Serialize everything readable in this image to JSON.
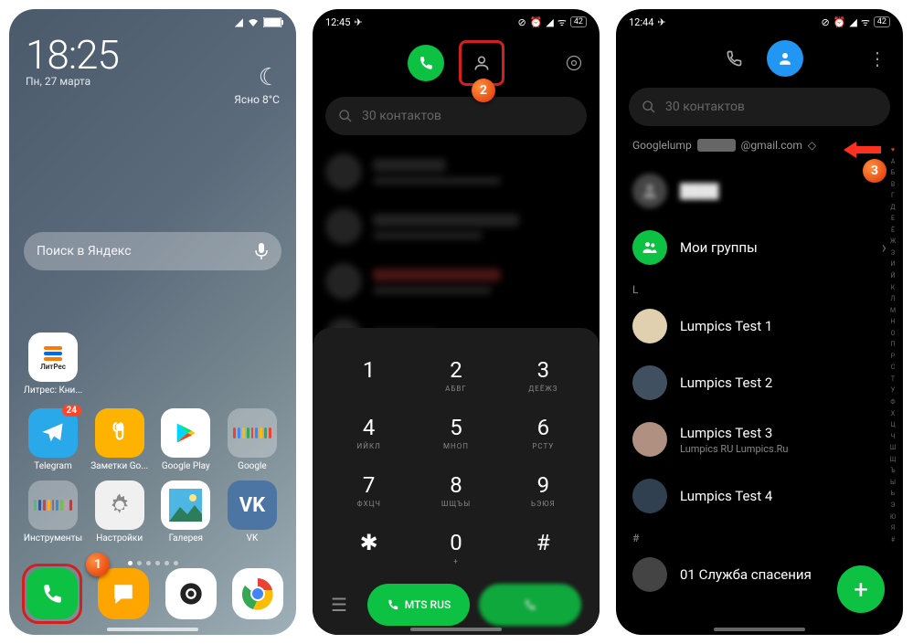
{
  "home": {
    "time": "18:25",
    "date": "Пн, 27 марта",
    "weather_label": "Ясно",
    "weather_temp": "8°C",
    "search_placeholder": "Поиск в Яндекс",
    "apps": {
      "litres": "Литрес: Кни...",
      "telegram": "Telegram",
      "telegram_badge": "24",
      "notes": "Заметки Go...",
      "playstore": "Google Play",
      "google": "Google",
      "tools": "Инструменты",
      "settings": "Настройки",
      "gallery": "Галерея",
      "vk": "VK"
    }
  },
  "s2": {
    "time": "12:45",
    "battery": "42",
    "search_placeholder": "30 контактов",
    "keypad": [
      {
        "n": "1",
        "s": ""
      },
      {
        "n": "2",
        "s": "АБВГ"
      },
      {
        "n": "3",
        "s": "ДЕЁЖЗ"
      },
      {
        "n": "4",
        "s": "ИЙКЛ"
      },
      {
        "n": "5",
        "s": "МНОП"
      },
      {
        "n": "6",
        "s": "РСТУ"
      },
      {
        "n": "7",
        "s": "ФХЦЧ"
      },
      {
        "n": "8",
        "s": "ШЩЪЫ"
      },
      {
        "n": "9",
        "s": "ЬЭЮЯ"
      },
      {
        "n": "✱",
        "s": ""
      },
      {
        "n": "0",
        "s": "+"
      },
      {
        "n": "#",
        "s": ""
      }
    ],
    "sim1": "MTS RUS"
  },
  "s3": {
    "time": "12:44",
    "battery": "42",
    "search_placeholder": "30 контактов",
    "account_prefix": "Googlelump",
    "account_suffix": "@gmail.com",
    "groups": "Мои группы",
    "section_l": "L",
    "contacts": [
      {
        "name": "Lumpics Test 1",
        "sub": ""
      },
      {
        "name": "Lumpics Test 2",
        "sub": ""
      },
      {
        "name": "Lumpics Test 3",
        "sub": "Lumpics RU Lumpics.Ru"
      },
      {
        "name": "Lumpics Test 4",
        "sub": ""
      }
    ],
    "section_hash": "#",
    "emergency": "01 Служба спасения",
    "alpha": [
      "♥",
      "А",
      "Б",
      "В",
      "Г",
      "Д",
      "Е",
      "Ё",
      "Ж",
      "З",
      "И",
      "Й",
      "К",
      "Л",
      "М",
      "Н",
      "О",
      "П",
      "Р",
      "С",
      "Т",
      "У",
      "Ф",
      "Х",
      "Ц",
      "Ч",
      "Ш",
      "Щ",
      "Ъ",
      "Ы",
      "Ь",
      "Э",
      "Ю",
      "Я",
      "#"
    ]
  },
  "markers": {
    "m1": "1",
    "m2": "2",
    "m3": "3"
  }
}
